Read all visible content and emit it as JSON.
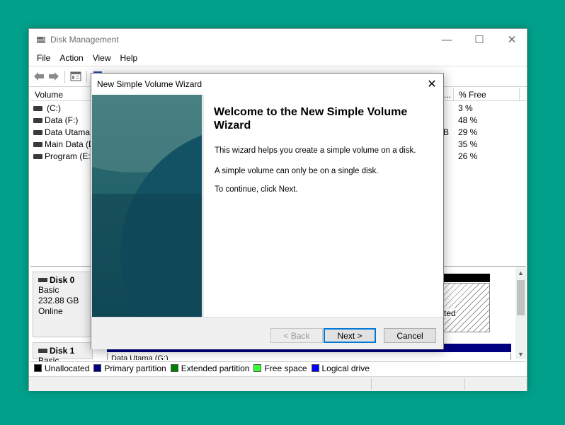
{
  "window": {
    "title": "Disk Management",
    "minimize_glyph": "—",
    "maximize_glyph": "☐",
    "close_glyph": "✕"
  },
  "menu": [
    "File",
    "Action",
    "View",
    "Help"
  ],
  "toolbar": {
    "icons": [
      "back-arrow-icon",
      "forward-arrow-icon",
      "properties-icon",
      "help-icon",
      "rescan-icon",
      "disk-list-icon"
    ]
  },
  "volume_table": {
    "columns": [
      "Volume",
      "...",
      "% Free"
    ],
    "rows": [
      {
        "volume": "(C:)",
        "free_pct": "3 %",
        "partial": ""
      },
      {
        "volume": "Data (F:)",
        "free_pct": "48 %",
        "partial": ""
      },
      {
        "volume": "Data Utama",
        "free_pct": "29 %",
        "partial": "B"
      },
      {
        "volume": "Main Data (D",
        "free_pct": "35 %",
        "partial": ""
      },
      {
        "volume": "Program (E:)",
        "free_pct": "26 %",
        "partial": ""
      }
    ]
  },
  "disks": [
    {
      "name": "Disk 0",
      "type": "Basic",
      "size": "232.88 GB",
      "status": "Online",
      "partition_fragment": "ted"
    },
    {
      "name": "Disk 1",
      "type": "Basic",
      "size": "",
      "status": "",
      "partition_fragment": "Data Utama (G:)"
    }
  ],
  "legend": [
    {
      "label": "Unallocated",
      "color": "#000000"
    },
    {
      "label": "Primary partition",
      "color": "#000080"
    },
    {
      "label": "Extended partition",
      "color": "#008000"
    },
    {
      "label": "Free space",
      "color": "#33ff33"
    },
    {
      "label": "Logical drive",
      "color": "#0000ff"
    }
  ],
  "wizard": {
    "title": "New Simple Volume Wizard",
    "close_glyph": "✕",
    "heading": "Welcome to the New Simple Volume Wizard",
    "paragraphs": [
      "This wizard helps you create a simple volume on a disk.",
      "A simple volume can only be on a single disk.",
      "To continue, click Next."
    ],
    "buttons": {
      "back": "< Back",
      "next": "Next >",
      "cancel": "Cancel"
    }
  }
}
